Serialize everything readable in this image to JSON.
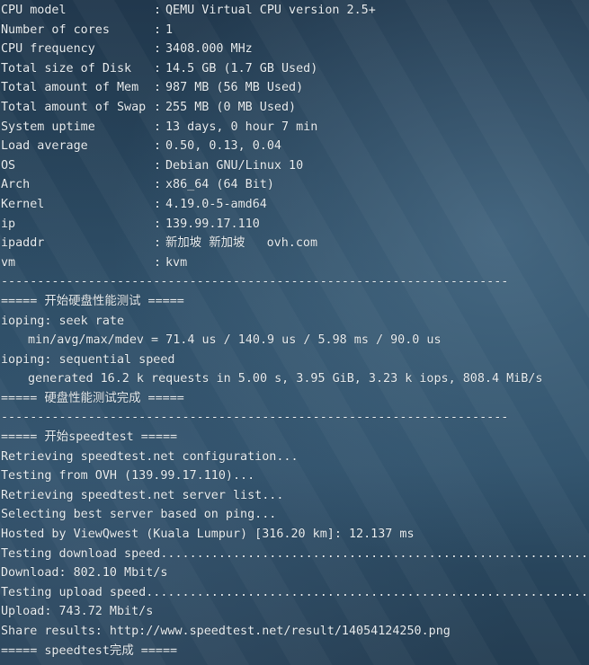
{
  "sysinfo": [
    {
      "key": "CPU model",
      "value": "QEMU Virtual CPU version 2.5+"
    },
    {
      "key": "Number of cores",
      "value": "1"
    },
    {
      "key": "CPU frequency",
      "value": "3408.000 MHz"
    },
    {
      "key": "Total size of Disk",
      "value": "14.5 GB (1.7 GB Used)"
    },
    {
      "key": "Total amount of Mem",
      "value": "987 MB (56 MB Used)"
    },
    {
      "key": "Total amount of Swap",
      "value": "255 MB (0 MB Used)"
    },
    {
      "key": "System uptime",
      "value": "13 days, 0 hour 7 min"
    },
    {
      "key": "Load average",
      "value": "0.50, 0.13, 0.04"
    },
    {
      "key": "OS",
      "value": "Debian GNU/Linux 10"
    },
    {
      "key": "Arch",
      "value": "x86_64 (64 Bit)"
    },
    {
      "key": "Kernel",
      "value": "4.19.0-5-amd64"
    },
    {
      "key": "ip",
      "value": "139.99.17.110"
    },
    {
      "key": "ipaddr",
      "value": "新加坡 新加坡   ovh.com"
    },
    {
      "key": "vm",
      "value": "kvm"
    }
  ],
  "separator": "----------------------------------------------------------------------",
  "disk": {
    "header": "===== 开始硬盘性能测试 =====",
    "seek_label": "ioping: seek rate",
    "seek_value": "min/avg/max/mdev = 71.4 us / 140.9 us / 5.98 ms / 90.0 us",
    "seq_label": "ioping: sequential speed",
    "seq_value": "generated 16.2 k requests in 5.00 s, 3.95 GiB, 3.23 k iops, 808.4 MiB/s",
    "footer": "===== 硬盘性能测试完成 ====="
  },
  "speedtest": {
    "header": "===== 开始speedtest =====",
    "lines": [
      "Retrieving speedtest.net configuration...",
      "Testing from OVH (139.99.17.110)...",
      "Retrieving speedtest.net server list...",
      "Selecting best server based on ping...",
      "Hosted by ViewQwest (Kuala Lumpur) [316.20 km]: 12.137 ms",
      "Testing download speed................................................................................",
      "Download: 802.10 Mbit/s",
      "Testing upload speed................................................................................",
      "Upload: 743.72 Mbit/s",
      "Share results: http://www.speedtest.net/result/14054124250.png"
    ],
    "footer": "===== speedtest完成 ====="
  }
}
